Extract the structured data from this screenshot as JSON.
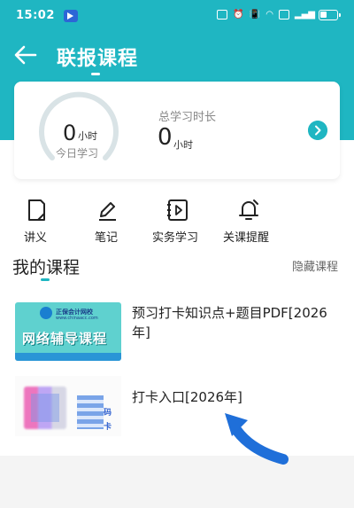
{
  "status_bar": {
    "time": "15:02"
  },
  "header": {
    "title": "联报课程"
  },
  "stats": {
    "today_value": "0",
    "today_unit": "小时",
    "today_label": "今日学习",
    "total_label": "总学习时长",
    "total_value": "0",
    "total_unit": "小时"
  },
  "quick_actions": [
    {
      "label": "讲义",
      "icon": "document-icon"
    },
    {
      "label": "笔记",
      "icon": "pencil-icon"
    },
    {
      "label": "实务学习",
      "icon": "play-icon"
    },
    {
      "label": "关课提醒",
      "icon": "bell-icon"
    }
  ],
  "my_courses": {
    "title": "我的课程",
    "hide_label": "隐藏课程",
    "items": [
      {
        "title": "预习打卡知识点+题目PDF[2026年]",
        "thumb_school": "正保会计网校",
        "thumb_url": "www.chinaacc.com",
        "thumb_banner": "网络辅导课程"
      },
      {
        "title": "打卡入口[2026年]",
        "thumb_char_1": "码",
        "thumb_char_2": "卡"
      }
    ]
  },
  "colors": {
    "accent": "#1fb6c2",
    "banner": "#5fd1cf",
    "arrow": "#1f6fd9"
  }
}
